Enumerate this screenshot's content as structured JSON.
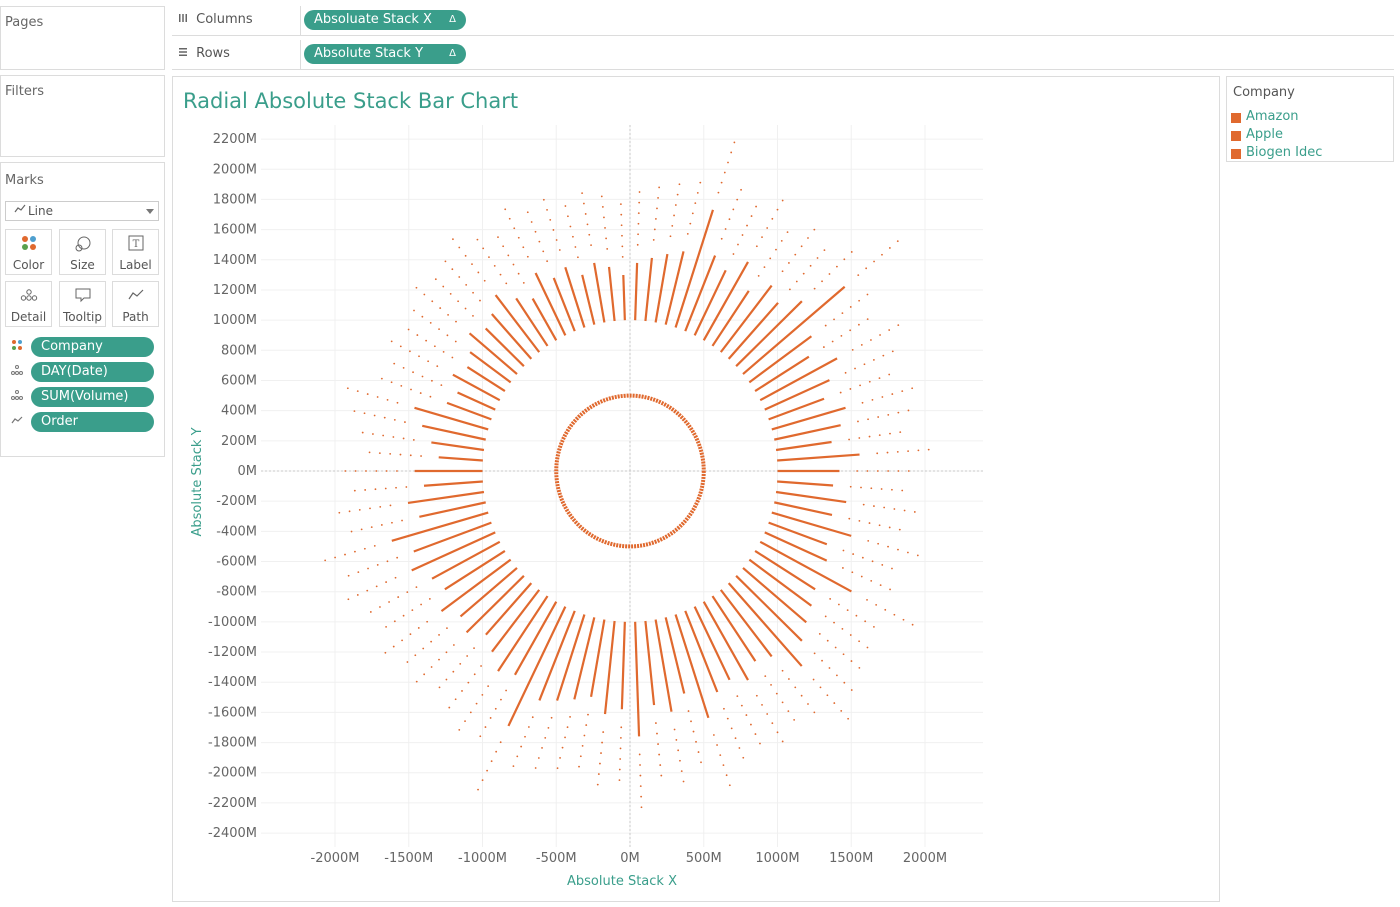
{
  "shelves": {
    "pages_label": "Pages",
    "filters_label": "Filters",
    "columns": {
      "label": "Columns",
      "pill": "Absoluate Stack X",
      "delta": "Δ"
    },
    "rows": {
      "label": "Rows",
      "pill": "Absolute Stack Y",
      "delta": "Δ"
    }
  },
  "marks": {
    "title": "Marks",
    "mark_type": "Line",
    "buttons": [
      {
        "label": "Color",
        "icon": "color-dots-icon"
      },
      {
        "label": "Size",
        "icon": "size-icon"
      },
      {
        "label": "Label",
        "icon": "label-icon"
      },
      {
        "label": "Detail",
        "icon": "detail-icon"
      },
      {
        "label": "Tooltip",
        "icon": "tooltip-icon"
      },
      {
        "label": "Path",
        "icon": "path-icon"
      }
    ],
    "fields": [
      {
        "label": "Company",
        "icon": "color-dots-icon"
      },
      {
        "label": "DAY(Date)",
        "icon": "detail-icon"
      },
      {
        "label": "SUM(Volume)",
        "icon": "detail-icon"
      },
      {
        "label": "Order",
        "icon": "path-icon"
      }
    ]
  },
  "legend": {
    "title": "Company",
    "items": [
      "Amazon",
      "Apple",
      "Biogen Idec"
    ],
    "color": "#e0692e"
  },
  "colors": {
    "accent": "#3a9e8b",
    "mark": "#e0692e"
  },
  "chart_data": {
    "type": "line",
    "title": "Radial Absolute Stack Bar Chart",
    "xlabel": "Absolute Stack X",
    "ylabel": "Absolute Stack Y",
    "x_ticks": [
      "-2000M",
      "-1500M",
      "-1000M",
      "-500M",
      "0M",
      "500M",
      "1000M",
      "1500M",
      "2000M"
    ],
    "y_ticks": [
      "2200M",
      "2000M",
      "1800M",
      "1600M",
      "1400M",
      "1200M",
      "1000M",
      "800M",
      "600M",
      "400M",
      "200M",
      "0M",
      "-200M",
      "-400M",
      "-600M",
      "-800M",
      "-1000M",
      "-1200M",
      "-1400M",
      "-1600M",
      "-1800M",
      "-2000M",
      "-2200M",
      "-2400M"
    ],
    "xlim": [
      -2400,
      2400
    ],
    "ylim": [
      -2450,
      2250
    ],
    "units": "M",
    "inner_ring_radius": 500,
    "bar_base_radius": 1000,
    "bars": [
      {
        "angle": 0,
        "length": 420
      },
      {
        "angle": 4,
        "length": 560
      },
      {
        "angle": 8,
        "length": 380
      },
      {
        "angle": 12,
        "length": 460
      },
      {
        "angle": 16,
        "length": 520
      },
      {
        "angle": 20,
        "length": 400
      },
      {
        "angle": 24,
        "length": 480
      },
      {
        "angle": 28,
        "length": 590
      },
      {
        "angle": 32,
        "length": 430
      },
      {
        "angle": 36,
        "length": 520
      },
      {
        "angle": 40,
        "length": 900
      },
      {
        "angle": 44,
        "length": 620
      },
      {
        "angle": 48,
        "length": 500
      },
      {
        "angle": 52,
        "length": 560
      },
      {
        "angle": 56,
        "length": 440
      },
      {
        "angle": 60,
        "length": 600
      },
      {
        "angle": 64,
        "length": 480
      },
      {
        "angle": 68,
        "length": 540
      },
      {
        "angle": 72,
        "length": 820
      },
      {
        "angle": 76,
        "length": 500
      },
      {
        "angle": 80,
        "length": 460
      },
      {
        "angle": 84,
        "length": 420
      },
      {
        "angle": 88,
        "length": 380
      },
      {
        "angle": 92,
        "length": 300
      },
      {
        "angle": 96,
        "length": 360
      },
      {
        "angle": 100,
        "length": 400
      },
      {
        "angle": 104,
        "length": 340
      },
      {
        "angle": 108,
        "length": 420
      },
      {
        "angle": 112,
        "length": 380
      },
      {
        "angle": 116,
        "length": 460
      },
      {
        "angle": 120,
        "length": 320
      },
      {
        "angle": 124,
        "length": 380
      },
      {
        "angle": 128,
        "length": 480
      },
      {
        "angle": 132,
        "length": 400
      },
      {
        "angle": 136,
        "length": 360
      },
      {
        "angle": 140,
        "length": 420
      },
      {
        "angle": 144,
        "length": 340
      },
      {
        "angle": 148,
        "length": 300
      },
      {
        "angle": 152,
        "length": 360
      },
      {
        "angle": 156,
        "length": 280
      },
      {
        "angle": 160,
        "length": 320
      },
      {
        "angle": 164,
        "length": 520
      },
      {
        "angle": 168,
        "length": 440
      },
      {
        "angle": 172,
        "length": 360
      },
      {
        "angle": 176,
        "length": 300
      },
      {
        "angle": 180,
        "length": 460
      },
      {
        "angle": 184,
        "length": 400
      },
      {
        "angle": 188,
        "length": 520
      },
      {
        "angle": 192,
        "length": 460
      },
      {
        "angle": 196,
        "length": 680
      },
      {
        "angle": 200,
        "length": 560
      },
      {
        "angle": 204,
        "length": 620
      },
      {
        "angle": 208,
        "length": 520
      },
      {
        "angle": 212,
        "length": 480
      },
      {
        "angle": 216,
        "length": 580
      },
      {
        "angle": 220,
        "length": 500
      },
      {
        "angle": 224,
        "length": 540
      },
      {
        "angle": 228,
        "length": 460
      },
      {
        "angle": 232,
        "length": 520
      },
      {
        "angle": 236,
        "length": 600
      },
      {
        "angle": 240,
        "length": 560
      },
      {
        "angle": 244,
        "length": 880
      },
      {
        "angle": 248,
        "length": 640
      },
      {
        "angle": 252,
        "length": 600
      },
      {
        "angle": 256,
        "length": 560
      },
      {
        "angle": 260,
        "length": 520
      },
      {
        "angle": 264,
        "length": 620
      },
      {
        "angle": 268,
        "length": 580
      },
      {
        "angle": 272,
        "length": 760
      },
      {
        "angle": 276,
        "length": 560
      },
      {
        "angle": 280,
        "length": 620
      },
      {
        "angle": 284,
        "length": 520
      },
      {
        "angle": 288,
        "length": 720
      },
      {
        "angle": 292,
        "length": 580
      },
      {
        "angle": 296,
        "length": 540
      },
      {
        "angle": 300,
        "length": 600
      },
      {
        "angle": 304,
        "length": 520
      },
      {
        "angle": 308,
        "length": 560
      },
      {
        "angle": 312,
        "length": 740
      },
      {
        "angle": 316,
        "length": 620
      },
      {
        "angle": 320,
        "length": 560
      },
      {
        "angle": 324,
        "length": 520
      },
      {
        "angle": 328,
        "length": 480
      },
      {
        "angle": 332,
        "length": 700
      },
      {
        "angle": 336,
        "length": 460
      },
      {
        "angle": 340,
        "length": 420
      },
      {
        "angle": 344,
        "length": 560
      },
      {
        "angle": 348,
        "length": 400
      },
      {
        "angle": 352,
        "length": 480
      },
      {
        "angle": 356,
        "length": 380
      }
    ]
  }
}
